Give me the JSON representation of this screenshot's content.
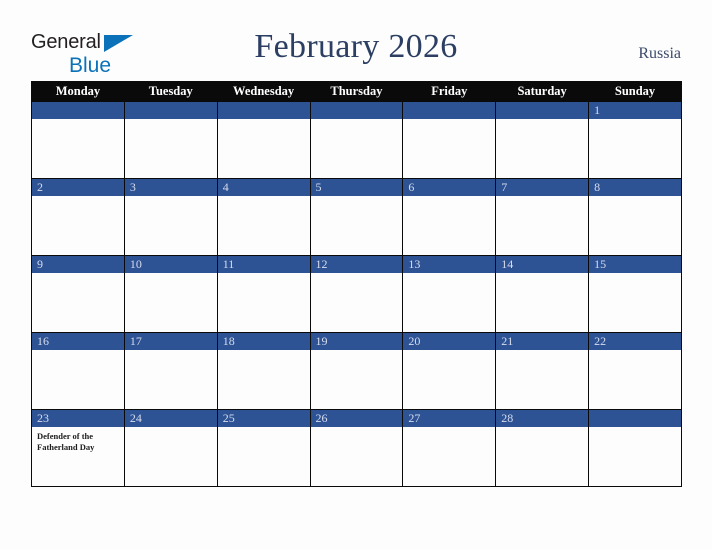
{
  "brand": {
    "word1": "General",
    "word2": "Blue",
    "triangle_color": "#0b72b9",
    "word1_color": "#231f20"
  },
  "header": {
    "title": "February 2026",
    "country": "Russia",
    "title_color": "#2c3f63"
  },
  "calendar": {
    "accent_color": "#2e5395",
    "header_bg": "#0a0a0a",
    "weekdays": [
      "Monday",
      "Tuesday",
      "Wednesday",
      "Thursday",
      "Friday",
      "Saturday",
      "Sunday"
    ],
    "weeks": [
      [
        {
          "day": "",
          "events": []
        },
        {
          "day": "",
          "events": []
        },
        {
          "day": "",
          "events": []
        },
        {
          "day": "",
          "events": []
        },
        {
          "day": "",
          "events": []
        },
        {
          "day": "",
          "events": []
        },
        {
          "day": "1",
          "events": []
        }
      ],
      [
        {
          "day": "2",
          "events": []
        },
        {
          "day": "3",
          "events": []
        },
        {
          "day": "4",
          "events": []
        },
        {
          "day": "5",
          "events": []
        },
        {
          "day": "6",
          "events": []
        },
        {
          "day": "7",
          "events": []
        },
        {
          "day": "8",
          "events": []
        }
      ],
      [
        {
          "day": "9",
          "events": []
        },
        {
          "day": "10",
          "events": []
        },
        {
          "day": "11",
          "events": []
        },
        {
          "day": "12",
          "events": []
        },
        {
          "day": "13",
          "events": []
        },
        {
          "day": "14",
          "events": []
        },
        {
          "day": "15",
          "events": []
        }
      ],
      [
        {
          "day": "16",
          "events": []
        },
        {
          "day": "17",
          "events": []
        },
        {
          "day": "18",
          "events": []
        },
        {
          "day": "19",
          "events": []
        },
        {
          "day": "20",
          "events": []
        },
        {
          "day": "21",
          "events": []
        },
        {
          "day": "22",
          "events": []
        }
      ],
      [
        {
          "day": "23",
          "events": [
            "Defender of the Fatherland Day"
          ]
        },
        {
          "day": "24",
          "events": []
        },
        {
          "day": "25",
          "events": []
        },
        {
          "day": "26",
          "events": []
        },
        {
          "day": "27",
          "events": []
        },
        {
          "day": "28",
          "events": []
        },
        {
          "day": "",
          "events": []
        }
      ]
    ]
  }
}
